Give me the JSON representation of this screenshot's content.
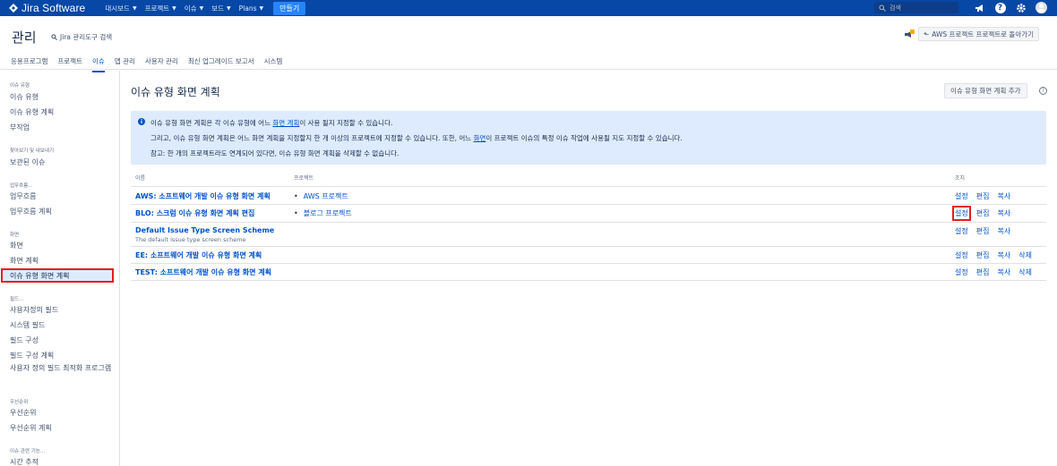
{
  "topnav": {
    "product": "Jira Software",
    "items": [
      {
        "label": "대시보드",
        "dropdown": true
      },
      {
        "label": "프로젝트",
        "dropdown": true
      },
      {
        "label": "이슈",
        "dropdown": true
      },
      {
        "label": "보드",
        "dropdown": true
      },
      {
        "label": "Plans",
        "dropdown": true
      }
    ],
    "create_label": "만들기",
    "search_placeholder": "검색",
    "colors": {
      "bar": "#0747a6",
      "create": "#2684ff"
    }
  },
  "admin": {
    "title": "관리",
    "search_label": "Jira 관리도구 검색",
    "tabs": [
      "응용프로그램",
      "프로젝트",
      "이슈",
      "앱 관리",
      "사용자 관리",
      "최신 업그레이드 보고서",
      "시스템"
    ],
    "active_tab": "이슈",
    "back_button": "AWS 프로젝트 프로젝트로 돌아가기"
  },
  "sidebar": {
    "groups": [
      {
        "title": "이슈 유형",
        "items": [
          "이슈 유형",
          "이슈 유형 계획",
          "부작업"
        ]
      },
      {
        "title": "찾아보기 및 내보내기",
        "items": [
          "보관된 이슈"
        ]
      },
      {
        "title": "업무흐름...",
        "items": [
          "업무흐름",
          "업무흐름 계획"
        ]
      },
      {
        "title": "화면",
        "items": [
          "화면",
          "화면 계획",
          "이슈 유형 화면 계획"
        ]
      },
      {
        "title": "필드...",
        "items": [
          "사용자정의 필드",
          "시스템 필드",
          "필드 구성",
          "필드 구성 계획",
          "사용자 정의 필드 최적화 프로그램"
        ]
      },
      {
        "title": "우선순위",
        "items": [
          "우선순위",
          "우선순위 계획"
        ]
      },
      {
        "title": "이슈 관련 기능...",
        "items": [
          "시간 추적"
        ]
      }
    ],
    "selected": "이슈 유형 화면 계획"
  },
  "main": {
    "title": "이슈 유형 화면 계획",
    "add_button": "이슈 유형 화면 계획 추가",
    "info": {
      "line1_pre": "이슈 유형 화면 계획은 각 이슈 유형에 어느 ",
      "line1_link": "화면 계획",
      "line1_post": "이 사용 될지 지정할 수 있습니다.",
      "line2_pre": "그리고, 이슈 유형 화면 계획은 어느 화면 계획을 지정할지 한 개 이상의 프로젝트에 지정할 수 있습니다. 또한, 어느 ",
      "line2_link": "화면",
      "line2_post": "이 프로젝트 이슈의 특정 이슈 작업에 사용될 지도 지정할 수 있습니다.",
      "line3": "참고: 한 개의 프로젝트라도 연계되어 있다면, 이슈 유형 화면 계획을 삭제할 수 없습니다."
    },
    "columns": [
      "이름",
      "프로젝트",
      "조치"
    ],
    "rows": [
      {
        "name": "AWS: 소프트웨어 개발 이슈 유형 화면 계획",
        "desc": "",
        "project": "AWS 프로젝트",
        "ops": [
          "설정",
          "편집",
          "복사"
        ]
      },
      {
        "name": "BLO: 스크럼 이슈 유형 화면 계획 편집",
        "desc": "",
        "project": "블로그 프로젝트",
        "ops": [
          "설정",
          "편집",
          "복사"
        ]
      },
      {
        "name": "Default Issue Type Screen Scheme",
        "desc": "The default issue type screen scheme",
        "project": "",
        "ops": [
          "설정",
          "편집",
          "복사"
        ]
      },
      {
        "name": "EE: 소프트웨어 개발 이슈 유형 화면 계획",
        "desc": "",
        "project": "",
        "ops": [
          "설정",
          "편집",
          "복사",
          "삭제"
        ]
      },
      {
        "name": "TEST: 소프트웨어 개발 이슈 유형 화면 계획",
        "desc": "",
        "project": "",
        "ops": [
          "설정",
          "편집",
          "복사",
          "삭제"
        ]
      }
    ],
    "link_color": "#0052cc",
    "highlight_color": "#e51c23"
  }
}
